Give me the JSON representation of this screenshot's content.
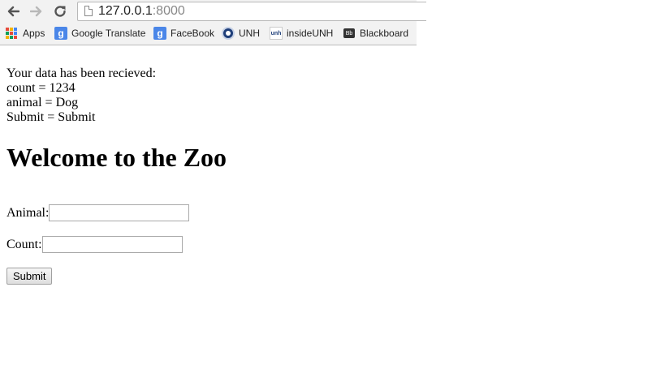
{
  "browser": {
    "url_host": "127.0.0.1",
    "url_port": ":8000",
    "bookmarks": [
      "Apps",
      "Google Translate",
      "FaceBook",
      "UNH",
      "insideUNH",
      "Blackboard"
    ],
    "icons": {
      "back": "back-arrow-icon",
      "forward": "forward-arrow-icon",
      "reload": "reload-icon",
      "page": "page-icon",
      "apps": "apps-grid-icon",
      "translate": "google-g-icon",
      "facebook": "google-g-icon",
      "unh": "unh-seal-icon",
      "insideunh": "insideunh-icon",
      "blackboard": "blackboard-icon"
    }
  },
  "page": {
    "received_text": "Your data has been recieved:",
    "lines": [
      "count = 1234",
      "animal = Dog",
      "Submit = Submit"
    ],
    "heading": "Welcome to the Zoo",
    "animal_label": "Animal:",
    "animal_value": "",
    "count_label": "Count:",
    "count_value": "",
    "submit_label": "Submit"
  }
}
